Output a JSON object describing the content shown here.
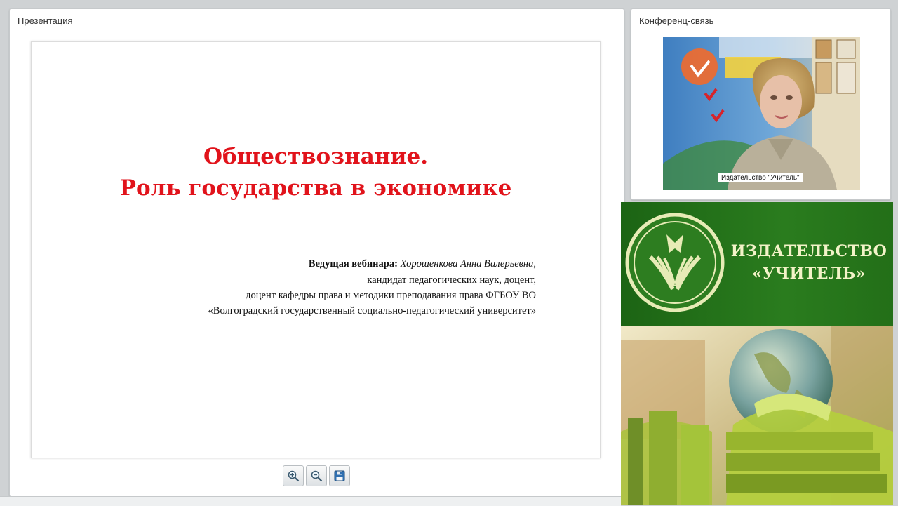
{
  "presentation_panel": {
    "title": "Презентация",
    "slide": {
      "title_line1": "Обществознание.",
      "title_line2": "Роль государства в экономике",
      "presenter_label": "Ведущая вебинара:",
      "presenter_name": "Хорошенкова Анна Валерьевна",
      "presenter_name_suffix": ",",
      "line2": "кандидат педагогических наук, доцент,",
      "line3": "доцент кафедры права и методики преподавания права ФГБОУ ВО",
      "line4": "«Волгоградский государственный социально-педагогический университет»"
    },
    "toolbar": {
      "zoom_in_icon": "zoom-in-icon",
      "zoom_out_icon": "zoom-out-icon",
      "save_icon": "floppy-disk-icon"
    }
  },
  "conference_panel": {
    "title": "Конференц-связь",
    "video_label": "Издательство \"Учитель\""
  },
  "brand": {
    "name_line1": "ИЗДАТЕЛЬСТВО",
    "name_line2": "«УЧИТЕЛЬ»",
    "background_color": "#1e6a16",
    "text_color": "#f3f3c8"
  },
  "colors": {
    "slide_title": "#e1131b",
    "page_background": "#cfd2d4"
  }
}
